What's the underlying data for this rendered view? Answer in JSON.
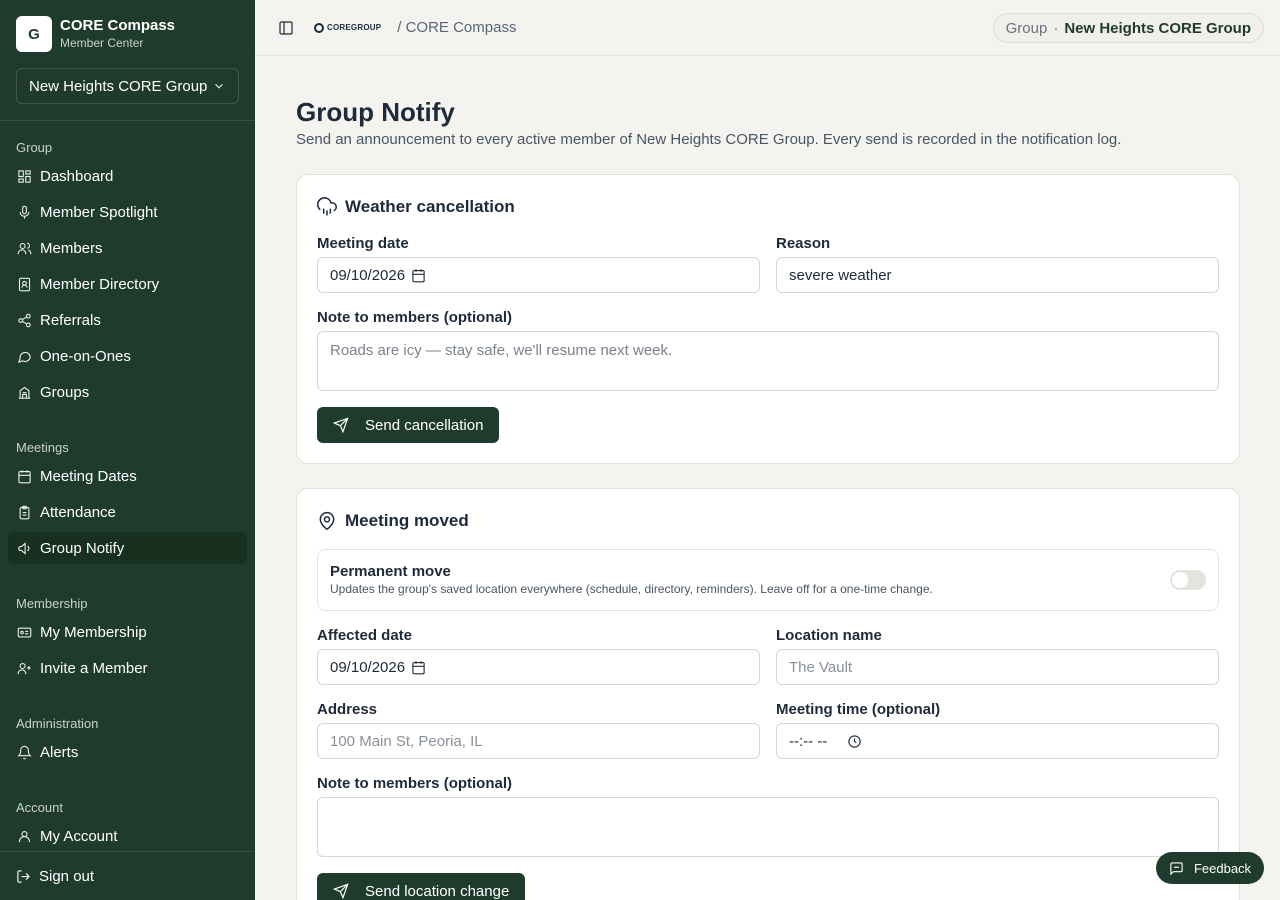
{
  "brand": {
    "logo_letter": "G",
    "title": "CORE Compass",
    "subtitle": "Member Center"
  },
  "group_selector": {
    "value": "New Heights CORE Group"
  },
  "nav": {
    "group_label": "Group",
    "group_items": [
      "Dashboard",
      "Member Spotlight",
      "Members",
      "Member Directory",
      "Referrals",
      "One-on-Ones",
      "Groups"
    ],
    "meetings_label": "Meetings",
    "meetings_items": [
      "Meeting Dates",
      "Attendance",
      "Group Notify"
    ],
    "membership_label": "Membership",
    "membership_items": [
      "My Membership",
      "Invite a Member"
    ],
    "admin_label": "Administration",
    "admin_items": [
      "Alerts"
    ],
    "account_label": "Account",
    "account_items": [
      "My Account"
    ],
    "sign_out": "Sign out"
  },
  "header": {
    "logo_text": "COREGROUP",
    "breadcrumb": "/ CORE Compass",
    "pill_label": "Group",
    "pill_separator": "·",
    "pill_value": "New Heights CORE Group"
  },
  "page": {
    "title": "Group Notify",
    "description": "Send an announcement to every active member of New Heights CORE Group. Every send is recorded in the notification log."
  },
  "weather": {
    "title": "Weather cancellation",
    "date_label": "Meeting date",
    "date_value": "09/10/2026",
    "reason_label": "Reason",
    "reason_value": "severe weather",
    "note_label": "Note to members (optional)",
    "note_placeholder": "Roads are icy — stay safe, we'll resume next week.",
    "button": "Send cancellation"
  },
  "moved": {
    "title": "Meeting moved",
    "permanent_title": "Permanent move",
    "permanent_desc": "Updates the group's saved location everywhere (schedule, directory, reminders). Leave off for a one-time change.",
    "permanent_on": false,
    "date_label": "Affected date",
    "date_value": "09/10/2026",
    "location_label": "Location name",
    "location_placeholder": "The Vault",
    "address_label": "Address",
    "address_placeholder": "100 Main St, Peoria, IL",
    "time_label": "Meeting time (optional)",
    "time_placeholder": "--:-- --",
    "note_label": "Note to members (optional)",
    "button": "Send location change"
  },
  "feedback": "Feedback"
}
